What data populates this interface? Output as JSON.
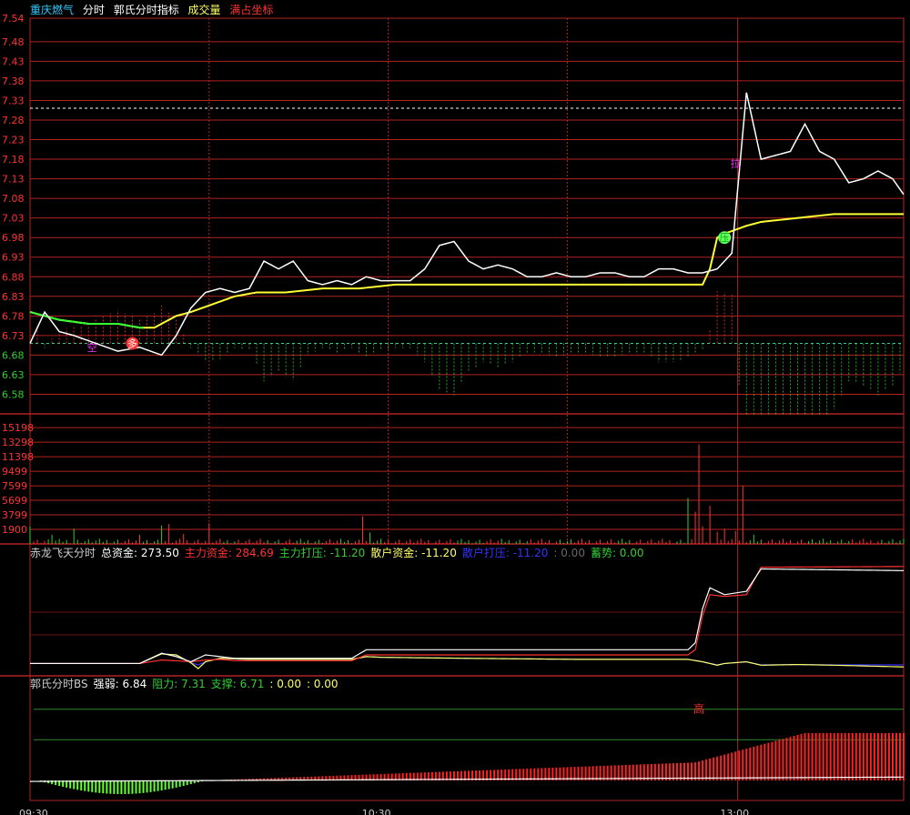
{
  "header": {
    "stock_name": "重庆燃气",
    "mode": "分时",
    "indicator": "郭氏分时指标",
    "volume_label": "成交量",
    "full_axis_label": "满占坐标"
  },
  "colors": {
    "bg": "#000000",
    "grid": "#b22222",
    "up": "#ff3333",
    "down": "#33cc33",
    "price": "#ffffff",
    "avg": "#ffff33",
    "white_text": "#ffffff",
    "cyan": "#33ccff",
    "yellow": "#ffff66",
    "magenta": "#ff33ff",
    "blue": "#3333ff"
  },
  "chart_data": [
    {
      "type": "line",
      "name": "price_panel",
      "y_ticks": [
        "7.54",
        "7.48",
        "7.43",
        "7.38",
        "7.33",
        "7.28",
        "7.23",
        "7.18",
        "7.13",
        "7.08",
        "7.03",
        "6.98",
        "6.93",
        "6.88",
        "6.83",
        "6.78",
        "6.73",
        "6.68",
        "6.63",
        "6.58"
      ],
      "ylim": [
        6.53,
        7.54
      ],
      "prev_close": 6.71,
      "high_ref": 7.31,
      "x_points": 240,
      "price_kx": [
        0,
        4,
        8,
        12,
        18,
        24,
        30,
        36,
        40,
        44,
        48,
        52,
        56,
        60,
        64,
        68,
        72,
        76,
        80,
        84,
        88,
        92,
        96,
        100,
        104,
        108,
        112,
        116,
        120,
        124,
        128,
        132,
        136,
        140,
        144,
        148,
        152,
        156,
        160,
        164,
        168,
        172,
        176,
        180,
        184,
        188,
        192,
        196,
        200,
        204,
        208,
        212,
        216,
        220,
        224,
        228,
        232,
        236,
        239
      ],
      "price_ky": [
        6.71,
        6.79,
        6.74,
        6.73,
        6.71,
        6.69,
        6.7,
        6.68,
        6.73,
        6.8,
        6.84,
        6.85,
        6.84,
        6.85,
        6.92,
        6.9,
        6.92,
        6.87,
        6.86,
        6.87,
        6.86,
        6.88,
        6.87,
        6.87,
        6.87,
        6.9,
        6.96,
        6.97,
        6.92,
        6.9,
        6.91,
        6.9,
        6.88,
        6.88,
        6.89,
        6.88,
        6.88,
        6.89,
        6.89,
        6.88,
        6.88,
        6.9,
        6.9,
        6.89,
        6.89,
        6.9,
        6.94,
        7.35,
        7.18,
        7.19,
        7.2,
        7.27,
        7.2,
        7.18,
        7.12,
        7.13,
        7.15,
        7.13,
        7.09
      ],
      "avg_kx": [
        0,
        8,
        16,
        24,
        30,
        34,
        36,
        40,
        44,
        50,
        56,
        62,
        70,
        80,
        90,
        100,
        120,
        140,
        160,
        180,
        184,
        186,
        188,
        190,
        196,
        200,
        210,
        220,
        239
      ],
      "avg_ky": [
        6.79,
        6.77,
        6.76,
        6.76,
        6.75,
        6.75,
        6.76,
        6.78,
        6.79,
        6.81,
        6.83,
        6.84,
        6.84,
        6.85,
        6.85,
        6.86,
        6.86,
        6.86,
        6.86,
        6.86,
        6.86,
        6.9,
        6.98,
        6.99,
        7.01,
        7.02,
        7.03,
        7.04,
        7.04
      ],
      "annotations": [
        {
          "text": "空",
          "kx": 17,
          "y": 6.7,
          "color": "#ff33ff"
        },
        {
          "text": "多",
          "kx": 28,
          "y": 6.71,
          "color": "#ffffff",
          "bg": "#ff3333"
        },
        {
          "text": "拉",
          "kx": 193,
          "y": 7.17,
          "color": "#ff33ff"
        },
        {
          "text": "压",
          "kx": 190,
          "y": 6.98,
          "color": "#00aa00",
          "bg": "#66ff66"
        }
      ]
    },
    {
      "type": "bar",
      "name": "volume_panel",
      "y_ticks": [
        "15198",
        "13298",
        "11398",
        "9499",
        "7599",
        "5699",
        "3799",
        "1900"
      ],
      "ylim": [
        0,
        17000
      ],
      "spikes": [
        {
          "kx": 0,
          "v": 2300
        },
        {
          "kx": 6,
          "v": 1200
        },
        {
          "kx": 12,
          "v": 2000
        },
        {
          "kx": 30,
          "v": 1200
        },
        {
          "kx": 36,
          "v": 2400
        },
        {
          "kx": 38,
          "v": 2600
        },
        {
          "kx": 42,
          "v": 1300
        },
        {
          "kx": 49,
          "v": 2700
        },
        {
          "kx": 91,
          "v": 3600
        },
        {
          "kx": 93,
          "v": 1500
        },
        {
          "kx": 180,
          "v": 6000
        },
        {
          "kx": 182,
          "v": 4200
        },
        {
          "kx": 183,
          "v": 13000
        },
        {
          "kx": 184,
          "v": 2300
        },
        {
          "kx": 186,
          "v": 5000
        },
        {
          "kx": 188,
          "v": 1600
        },
        {
          "kx": 190,
          "v": 2000
        },
        {
          "kx": 193,
          "v": 1700
        },
        {
          "kx": 195,
          "v": 7600
        },
        {
          "kx": 198,
          "v": 1200
        }
      ]
    },
    {
      "type": "line",
      "name": "fund_panel",
      "legend": [
        {
          "label": "赤龙飞天分时",
          "value": "",
          "color": "#cccccc"
        },
        {
          "label": "总资金:",
          "value": "273.50",
          "color": "#ffffff"
        },
        {
          "label": "主力资金:",
          "value": "284.69",
          "color": "#ff3333"
        },
        {
          "label": "主力打压:",
          "value": "-11.20",
          "color": "#33cc33"
        },
        {
          "label": "散户资金:",
          "value": "-11.20",
          "color": "#ffff66"
        },
        {
          "label": "散户打压:",
          "value": "-11.20",
          "color": "#3333ff"
        },
        {
          "label": ":",
          "value": "0.00",
          "color": "#666666"
        },
        {
          "label": "蓄势:",
          "value": "0.00",
          "color": "#33cc33"
        }
      ],
      "ylim": [
        -20,
        300
      ],
      "total_kx": [
        0,
        30,
        36,
        40,
        44,
        48,
        52,
        56,
        60,
        70,
        80,
        88,
        92,
        96,
        120,
        140,
        160,
        180,
        182,
        184,
        186,
        190,
        196,
        200,
        239
      ],
      "total_ky": [
        0,
        0,
        30,
        20,
        5,
        25,
        20,
        15,
        15,
        15,
        15,
        15,
        40,
        40,
        40,
        40,
        40,
        40,
        60,
        160,
        220,
        200,
        210,
        275,
        270
      ],
      "main_kx": [
        0,
        30,
        36,
        40,
        44,
        48,
        52,
        56,
        60,
        70,
        80,
        88,
        92,
        96,
        120,
        140,
        160,
        180,
        182,
        184,
        186,
        190,
        196,
        200,
        239
      ],
      "main_ky": [
        0,
        0,
        10,
        8,
        5,
        10,
        12,
        8,
        8,
        8,
        8,
        8,
        25,
        25,
        25,
        25,
        25,
        25,
        40,
        140,
        200,
        195,
        200,
        280,
        282
      ],
      "retail_kx": [
        0,
        30,
        36,
        40,
        44,
        46,
        48,
        52,
        60,
        80,
        88,
        92,
        96,
        120,
        150,
        160,
        180,
        184,
        188,
        190,
        196,
        200,
        210,
        220,
        239
      ],
      "retail_ky": [
        0,
        0,
        28,
        25,
        2,
        -15,
        5,
        15,
        12,
        12,
        12,
        20,
        18,
        15,
        12,
        12,
        12,
        5,
        -5,
        0,
        5,
        -5,
        -3,
        -5,
        -10
      ]
    },
    {
      "type": "bar",
      "name": "bs_panel",
      "legend": [
        {
          "label": "郭氏分时BS",
          "value": "",
          "color": "#cccccc"
        },
        {
          "label": "强弱:",
          "value": "6.84",
          "color": "#ffffff"
        },
        {
          "label": "阻力:",
          "value": "7.31",
          "color": "#33cc33"
        },
        {
          "label": "支撑:",
          "value": "6.71",
          "color": "#33cc33"
        },
        {
          "label": ":",
          "value": "0.00",
          "color": "#ffff66"
        },
        {
          "label": ":",
          "value": "0.00",
          "color": "#ffff66"
        }
      ],
      "top_label": {
        "text": "高",
        "kx": 183
      },
      "ylim": [
        -1.6,
        7.0
      ],
      "resistance": 7.31
    }
  ],
  "time_axis": [
    "09:30",
    "10:30",
    "13:00"
  ]
}
